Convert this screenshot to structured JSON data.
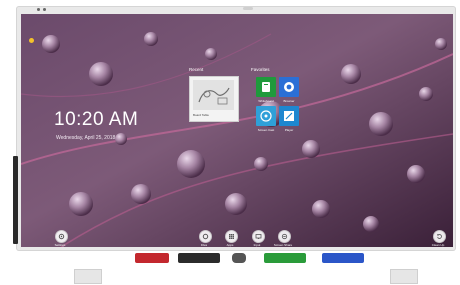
{
  "home": {
    "time": "10:20 AM",
    "date": "Wednesday, April 25, 2018",
    "recent": {
      "title": "Recent",
      "items": [
        {
          "caption": "Board Table"
        }
      ]
    },
    "favorites": {
      "title": "Favorites",
      "items": [
        {
          "label": "Whiteboard",
          "icon": "whiteboard-icon",
          "color": "#1f9a3c"
        },
        {
          "label": "Browser",
          "icon": "browser-icon",
          "color": "#2b6fd6"
        },
        {
          "label": "Screen Cast",
          "icon": "screen-cast-icon",
          "color": "#2fa0d8"
        },
        {
          "label": "Player",
          "icon": "player-icon",
          "color": "#1e87d0"
        }
      ]
    },
    "toolbar": {
      "left": [
        {
          "label": "Settings",
          "icon": "gear-icon"
        }
      ],
      "center": [
        {
          "label": "Files",
          "icon": "files-icon"
        },
        {
          "label": "Apps",
          "icon": "apps-grid-icon"
        },
        {
          "label": "Input",
          "icon": "input-icon"
        },
        {
          "label": "Screen Share",
          "icon": "screen-share-icon"
        }
      ],
      "right": [
        {
          "label": "Clean Up",
          "icon": "clean-up-icon"
        }
      ]
    }
  },
  "hardware": {
    "pens": [
      {
        "name": "pen-tray-red",
        "color": "#c3282e"
      },
      {
        "name": "pen-tray-black",
        "color": "#2b2b2b"
      },
      {
        "name": "pen-tray-green",
        "color": "#2a9b3a"
      },
      {
        "name": "pen-tray-blue",
        "color": "#2b56c8"
      }
    ]
  }
}
